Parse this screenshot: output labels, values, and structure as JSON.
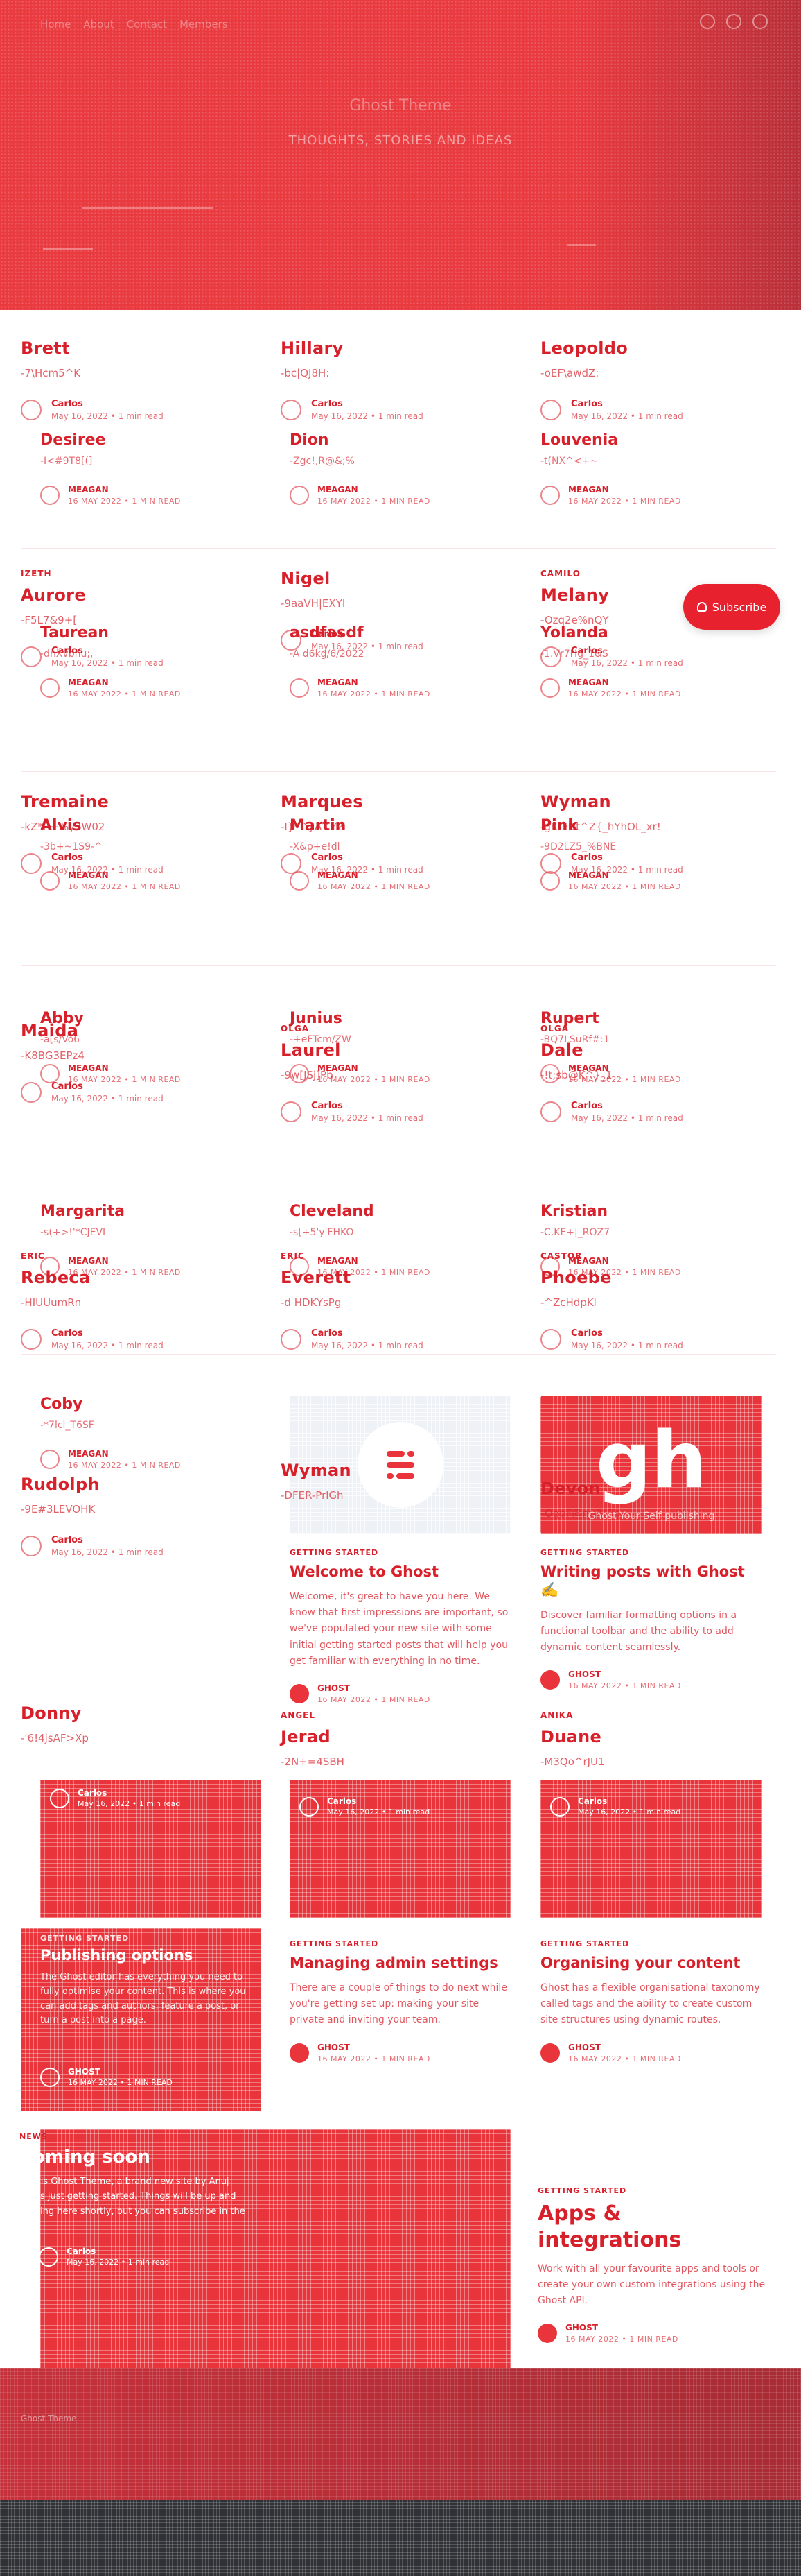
{
  "hero": {
    "nav": [
      "Home",
      "About",
      "Contact",
      "Members"
    ],
    "title": "Ghost Theme",
    "subtitle": "THOUGHTS, STORIES AND IDEAS"
  },
  "subscribe": {
    "label": "Subscribe"
  },
  "author_card": {
    "author": "Carlos",
    "meta": "May 16, 2022 • 1 min read"
  },
  "overlay_meta": {
    "author": "MEAGAN",
    "meta": "16 MAY 2022 • 1 MIN READ"
  },
  "cards": [
    {
      "name": "Brett",
      "rand": "-7\\Hcm5^K",
      "tag": ""
    },
    {
      "name": "Hillary",
      "rand": "-bc|QJ8H:",
      "tag": ""
    },
    {
      "name": "Leopoldo",
      "rand": "-oEF\\awdZ:",
      "tag": ""
    },
    {
      "name": "Aurore",
      "rand": "-F5L7&9+[",
      "tag": "IZETH"
    },
    {
      "name": "Nigel",
      "rand": "-9aaVH|EXYI",
      "tag": ""
    },
    {
      "name": "Melany",
      "rand": "-Ozq2e%nQY",
      "tag": "CAMILO"
    },
    {
      "name": "Tremaine",
      "rand": "-kZ*R+%y7W02",
      "tag": ""
    },
    {
      "name": "Marques",
      "rand": "-I}*^}A^Y2",
      "tag": ""
    },
    {
      "name": "Wyman",
      "rand": "-gKrFDt^Z{_hYhOL_xr!",
      "tag": ""
    },
    {
      "name": "Maida",
      "rand": "-K8BG3EPz4",
      "tag": ""
    },
    {
      "name": "Laurel",
      "rand": "-9w[JSj]Pb",
      "tag": "OLGA"
    },
    {
      "name": "Dale",
      "rand": "-!t;sb@K^}_1",
      "tag": "OLGA"
    },
    {
      "name": "Rebeca",
      "rand": "-HIUUumRn",
      "tag": "ERIC"
    },
    {
      "name": "Everett",
      "rand": "-d HDKYsPg",
      "tag": "ERIC"
    },
    {
      "name": "Phoebe",
      "rand": "-^ZcHdpKl",
      "tag": "CASTOR"
    },
    {
      "name": "Rudolph",
      "rand": "-9E#3LEVOHK",
      "tag": ""
    },
    {
      "name": "Wyman",
      "rand": "-DFER-PrlGh",
      "tag": ""
    },
    {
      "name": "Devon",
      "rand": "-OgbF@nqR(Rb",
      "tag": ""
    },
    {
      "name": "Donny",
      "rand": "-'6!4jsAF>Xp",
      "tag": ""
    },
    {
      "name": "Jerad",
      "rand": "-2N+=4SBH",
      "tag": "ANGEL"
    },
    {
      "name": "Duane",
      "rand": "-M3Qo^rJU1",
      "tag": "ANIKA"
    }
  ],
  "overlays": [
    {
      "name": "Desiree",
      "rand": "-I<#9T8[(]"
    },
    {
      "name": "Dion",
      "rand": "-Zgc!,R@&;%"
    },
    {
      "name": "Louvenia",
      "rand": "-t(NX^<+~"
    },
    {
      "name": "Taurean",
      "rand": "-dnXvbnu;,"
    },
    {
      "name": "asdfasdf",
      "rand": "-A d6kg/6/2022"
    },
    {
      "name": "Yolanda",
      "rand": "-1.Vr7Hg_1&S"
    },
    {
      "name": "Alvis",
      "rand": "-3b+~1S9-^"
    },
    {
      "name": "Martin",
      "rand": "-X&p+e!dl"
    },
    {
      "name": "Pink",
      "rand": "-9D2LZ5_%BNE"
    },
    {
      "name": "Abby",
      "rand": "-a[s/Vo6"
    },
    {
      "name": "Junius",
      "rand": "-+eFTcm/ZW"
    },
    {
      "name": "Rupert",
      "rand": "-BQ7LSuRf#:1"
    },
    {
      "name": "Margarita",
      "rand": "-s(+>!'*CJEVI"
    },
    {
      "name": "Cleveland",
      "rand": "-s[+5'y'FHKO"
    },
    {
      "name": "Kristian",
      "rand": "-C.KE+|_ROZ7"
    },
    {
      "name": "Coby",
      "rand": "-*7lcl_T6SF"
    }
  ],
  "featured": [
    {
      "tag": "GETTING STARTED",
      "title": "Welcome to Ghost",
      "excerpt": "Welcome, it's great to have you here. We know that first impressions are important, so we've populated your new site with some initial getting started posts that will help you get familiar with everything in no time.",
      "author": "GHOST",
      "meta": "16 MAY 2022 • 1 MIN READ"
    },
    {
      "tag": "GETTING STARTED",
      "title": "Writing posts with Ghost ✍️",
      "excerpt": "Discover familiar formatting options in a functional toolbar and the ability to add dynamic content seamlessly.",
      "author": "GHOST",
      "meta": "16 MAY 2022 • 1 MIN READ",
      "img_caption": "Ghost Your Self publishing"
    },
    {
      "tag": "GETTING STARTED",
      "title": "Managing admin settings",
      "excerpt": "There are a couple of things to do next while you're getting set up: making your site private and inviting your team.",
      "author": "GHOST",
      "meta": "16 MAY 2022 • 1 MIN READ"
    },
    {
      "tag": "GETTING STARTED",
      "title": "Organising your content",
      "excerpt": "Ghost has a flexible organisational taxonomy called tags and the ability to create custom site structures using dynamic routes.",
      "author": "GHOST",
      "meta": "16 MAY 2022 • 1 MIN READ"
    },
    {
      "tag": "GETTING STARTED",
      "title": "Apps & integrations",
      "excerpt": "Work with all your favourite apps and tools or create your own custom integrations using the Ghost API.",
      "author": "GHOST",
      "meta": "16 MAY 2022 • 1 MIN READ"
    }
  ],
  "redblocks": {
    "publishing": {
      "tag": "GETTING STARTED",
      "title": "Publishing options",
      "excerpt": "The Ghost editor has everything you need to fully optimise your content. This is where you can add tags and authors, feature a post, or turn a post into a page.",
      "author": "GHOST",
      "meta": "16 MAY 2022 • 1 MIN READ"
    },
    "coming": {
      "tag": "NEWS",
      "title": "Coming soon",
      "excerpt": "This is Ghost Theme, a brand new site by Anuj that's just getting started. Things will be up and running here shortly, but you can subscribe in the meantime if you'd like to stay up to date and receive emails when new content is published!"
    },
    "wmeta": {
      "author": "Carlos",
      "meta": "May 16, 2022 • 1 min read"
    }
  },
  "footer": {
    "label": "Ghost Theme"
  }
}
